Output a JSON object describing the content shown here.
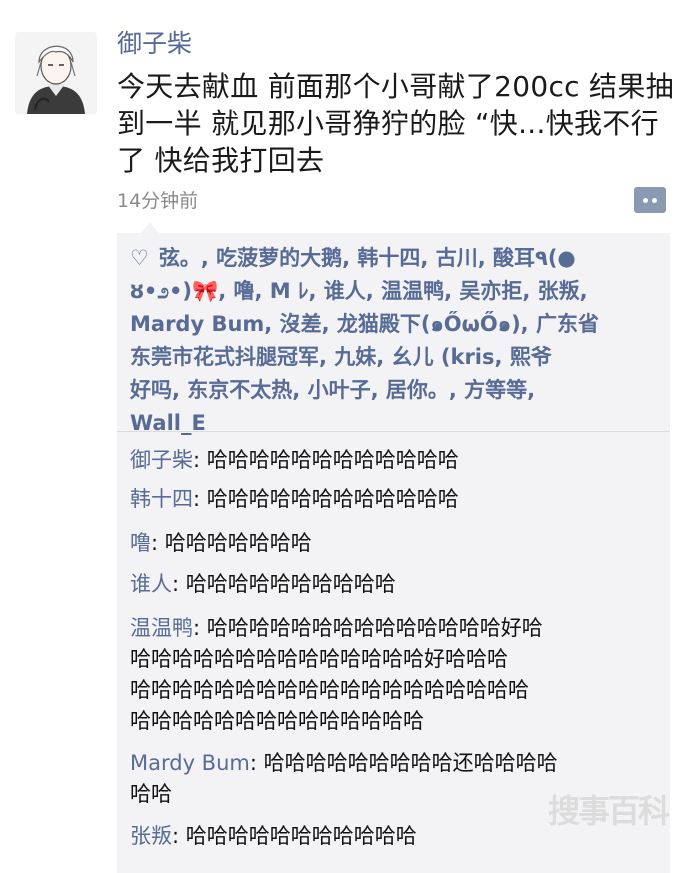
{
  "post": {
    "author": "御子柴",
    "text_lines": [
      "今天去献血 前面那个小哥献了200cc 结果抽",
      "到一半 就见那小哥狰狞的脸 “快...快我不行",
      "了  快给我打回去"
    ],
    "time": "14分钟前"
  },
  "likes": {
    "lines": [
      "弦。, 吃菠萝的大鹅, 韩十四, 古川, 酸耳٩(●",
      ", 噜, M ﾚ, 谁人, 温温鸭, 吴亦拒, 张叛,",
      "Mardy Bum, 沒差, 龙猫殿下(๑ŐωŐ๑), 广东省",
      "东莞市花式抖腿冠军, 九妹, 幺儿 (kris, 熙爷",
      "好吗, 东京不太热, 小叶子, 居你。, 方等等,",
      "Wall_E"
    ],
    "line2_prefix": "ȣ•೨•)",
    "bow": "🎀"
  },
  "comments": [
    {
      "author": "御子柴",
      "text_lines": [
        "哈哈哈哈哈哈哈哈哈哈哈哈"
      ]
    },
    {
      "author": "韩十四",
      "text_lines": [
        "哈哈哈哈哈哈哈哈哈哈哈哈"
      ]
    },
    {
      "author": "噜",
      "text_lines": [
        "哈哈哈哈哈哈哈"
      ]
    },
    {
      "author": "谁人",
      "text_lines": [
        "哈哈哈哈哈哈哈哈哈哈"
      ]
    },
    {
      "author": "温温鸭",
      "text_lines": [
        "哈哈哈哈哈哈哈哈哈哈哈哈哈哈好哈",
        "哈哈哈哈哈哈哈哈哈哈哈哈哈哈好哈哈哈",
        "哈哈哈哈哈哈哈哈哈哈哈哈哈哈哈哈哈哈哈",
        "哈哈哈哈哈哈哈哈哈哈哈哈哈哈"
      ]
    },
    {
      "author": "Mardy Bum",
      "text_lines": [
        "哈哈哈哈哈哈哈哈哈还哈哈哈哈",
        "哈哈"
      ]
    },
    {
      "author": "张叛",
      "text_lines": [
        "哈哈哈哈哈哈哈哈哈哈哈"
      ]
    }
  ],
  "watermark": "搜事百科",
  "icons": {
    "like": "heart-outline-icon",
    "more": "more-dots-icon"
  },
  "colors": {
    "link": "#576b95",
    "panel": "#f3f3f5",
    "text": "#111111",
    "muted": "#8a8a8a"
  }
}
